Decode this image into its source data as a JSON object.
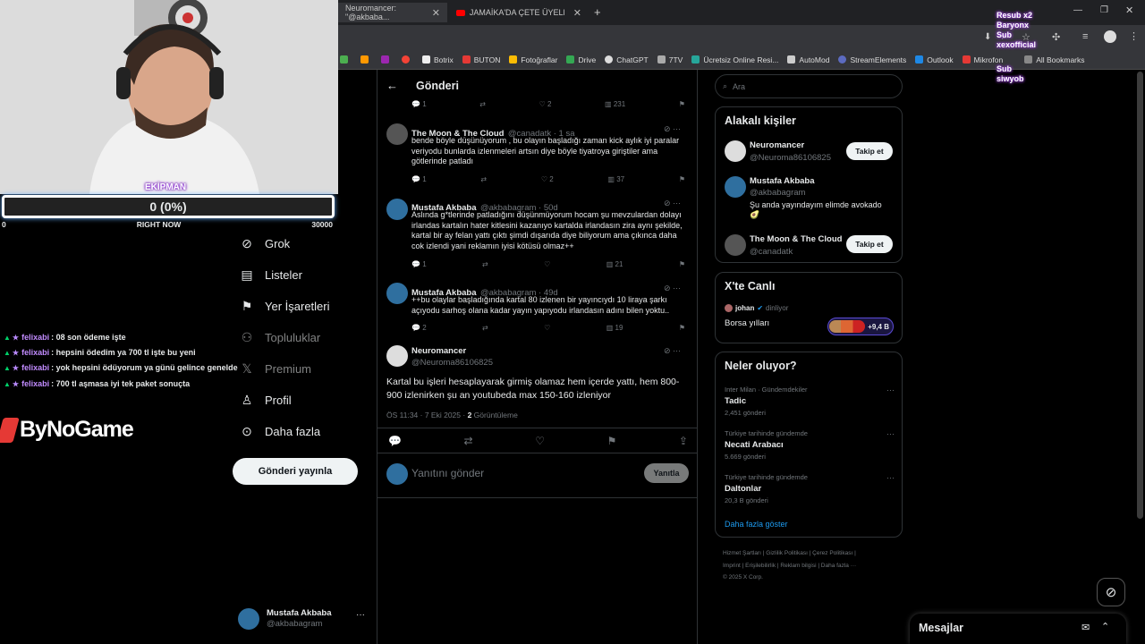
{
  "browser": {
    "tabs": [
      {
        "label": "Neuromancer: \"@akbaba..."
      },
      {
        "label": "JAMAİKA'DA ÇETE ÜYELERİYLE..."
      }
    ],
    "bookmarks": [
      "Botrix",
      "BUTON",
      "Fotoğraflar",
      "Drive",
      "ChatGPT",
      "7TV",
      "Ücretsiz Online Resi...",
      "AutoMod",
      "StreamElements",
      "Outlook",
      "Mikrofon"
    ],
    "all_bookmarks": "All Bookmarks"
  },
  "overlay": {
    "resub": "Resub x2",
    "resub_user": "Baryonx",
    "sub1": "Sub",
    "sub1_user": "xexofficial",
    "sub2": "Sub",
    "sub2_user": "siwyob",
    "goal_label": "EKİPMAN",
    "goal_value": "0 (0%)",
    "goal_min": "0",
    "goal_now": "RIGHT NOW",
    "goal_max": "30000",
    "chat": [
      {
        "user": "felixabi",
        "text": ": 08 son ödeme işte"
      },
      {
        "user": "felixabi",
        "text": ": hepsini ödedim ya 700 tl işte bu yeni"
      },
      {
        "user": "felixabi",
        "text": ": yok hepsini ödüyorum ya günü gelince genelde"
      },
      {
        "user": "felixabi",
        "text": ": 700 tl aşmasa iyi tek paket sonuçta"
      }
    ],
    "sponsor": "ByNoGame"
  },
  "nav": {
    "items": [
      "Grok",
      "Listeler",
      "Yer İşaretleri",
      "Topluluklar",
      "Premium",
      "Profil",
      "Daha fazla"
    ],
    "post_button": "Gönderi yayınla",
    "account_name": "Mustafa Akbaba",
    "account_handle": "@akbabagram"
  },
  "center": {
    "header": "Gönderi",
    "top_actions": {
      "reply": "1",
      "like": "2",
      "views": "231"
    },
    "replies": [
      {
        "name": "The Moon & The Cloud",
        "handle": "@canadatk · 1 sa",
        "text": "bende böyle düşünüyorum , bu olayın başladığı zaman kick aylık iyi paralar veriyodu bunlarda izlenmeleri artsın diye böyle tiyatroya giriştiler ama götlerinde patladı",
        "reply": "1",
        "like": "2",
        "views": "37"
      },
      {
        "name": "Mustafa Akbaba",
        "handle": "@akbabagram · 50d",
        "text": "Aslında g*tlerinde patladığını düşünmüyorum hocam şu mevzulardan dolayı irlandas kartalın hater kitlesini kazanıyo kartalda irlandasın zira aynı şekilde, kartal bir ay felan yattı çıktı şimdi dışarıda diye biliyorum ama çıkınca daha cok izlendi yani reklamın iyisi kötüsü olmaz++",
        "reply": "1",
        "like": "",
        "views": "21"
      },
      {
        "name": "Mustafa Akbaba",
        "handle": "@akbabagram · 49d",
        "text": "++bu olaylar başladığında kartal 80 izlenen bir yayıncıydı 10 liraya şarkı açıyodu sarhoş olana kadar yayın yapıyodu irlandasın adını bilen yoktu..",
        "reply": "2",
        "like": "",
        "views": "19"
      }
    ],
    "main_post": {
      "name": "Neuromancer",
      "handle": "@Neuroma86106825",
      "text": "Kartal bu işleri hesaplayarak girmiş olamaz hem içerde yattı, hem 800-900 izlenirken şu an youtubeda max 150-160 izleniyor",
      "meta": "ÖS 11:34 · 7 Eki 2025 · ",
      "views_count": "2",
      "views_label": "Görüntüleme"
    },
    "reply_placeholder": "Yanıtını gönder",
    "reply_button": "Yanıtla"
  },
  "right": {
    "search_placeholder": "Ara",
    "related_title": "Alakalı kişiler",
    "people": [
      {
        "name": "Neuromancer",
        "handle": "@Neuroma86106825",
        "follow": "Takip et"
      },
      {
        "name": "Mustafa Akbaba",
        "handle": "@akbabagram",
        "bio": "Şu anda yayındayım elimde avokado 🥑"
      },
      {
        "name": "The Moon & The Cloud",
        "handle": "@canadatk",
        "follow": "Takip et"
      }
    ],
    "live_title": "X'te Canlı",
    "live_host": "johan",
    "live_status": "dinliyor",
    "live_topic": "Borsa yılları",
    "live_count": "+9,4 B",
    "trends_title": "Neler oluyor?",
    "trends": [
      {
        "context": "Inter Milan · Gündemdekiler",
        "name": "Tadic",
        "posts": "2,451 gönderi"
      },
      {
        "context": "Türkiye tarihinde gündemde",
        "name": "Necati Arabacı",
        "posts": "5.669 gönderi"
      },
      {
        "context": "Türkiye tarihinde gündemde",
        "name": "Daltonlar",
        "posts": "20,3 B gönderi"
      }
    ],
    "show_more": "Daha fazla göster",
    "footer1": "Hizmet Şartları | Gizlilik Politikası | Çerez Politikası |",
    "footer2": "Imprint | Erişilebilirlik | Reklam bilgisi | Daha fazla ···",
    "footer3": "© 2025 X Corp.",
    "messages": "Mesajlar"
  }
}
